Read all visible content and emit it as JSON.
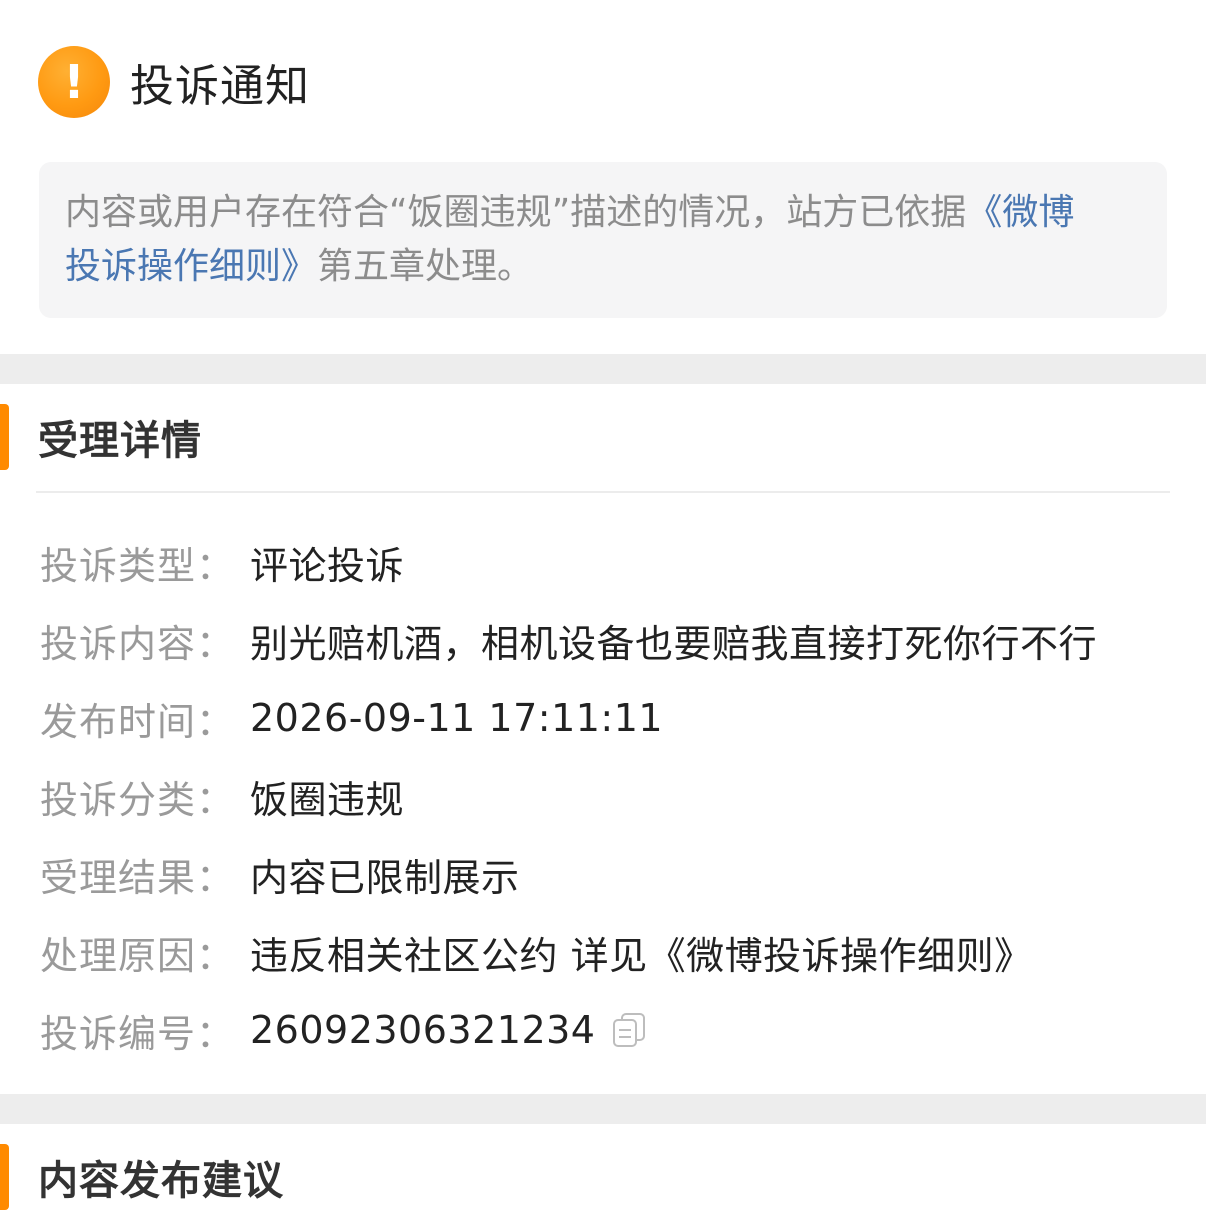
{
  "notice": {
    "icon": "exclamation-icon",
    "icon_color": "#ff9a12",
    "title": "投诉通知",
    "message_text": "内容或用户存在符合“饭圈违规”描述的情况，站方已依据",
    "message_link": "《微博投诉操作细则》",
    "message_suffix": "第五章处理。",
    "link_color": "#4a77b2"
  },
  "details": {
    "title": "受理详情",
    "accent_color": "#ff8a00",
    "rows": [
      {
        "label": "投诉类型：",
        "value": "评论投诉"
      },
      {
        "label": "投诉内容：",
        "value": "别光赔机酒，相机设备也要赔我直接打死你行不行"
      },
      {
        "label": "发布时间：",
        "value": "2026-09-11 17:11:11"
      },
      {
        "label": "投诉分类：",
        "value": "饭圈违规"
      },
      {
        "label": "受理结果：",
        "value": "内容已限制展示"
      },
      {
        "label": "处理原因：",
        "value": "违反相关社区公约 详见",
        "link": "《微博投诉操作细则》"
      },
      {
        "label": "投诉编号：",
        "value": "26092306321234",
        "icon": "copy-icon"
      }
    ]
  },
  "suggestion": {
    "title": "内容发布建议"
  }
}
